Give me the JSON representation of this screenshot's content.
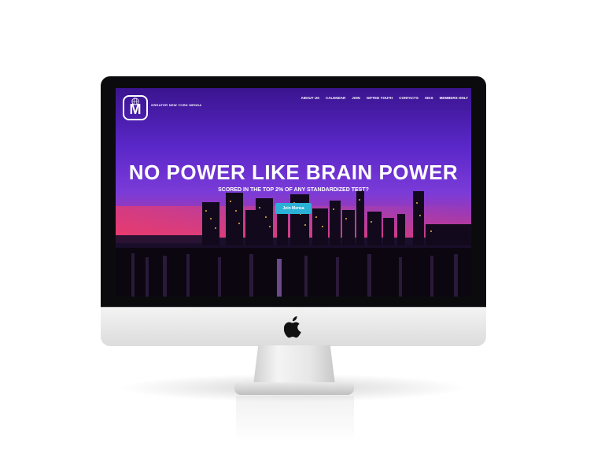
{
  "site": {
    "brand": "GREATER NEW YORK MENSA",
    "logo_letter": "M"
  },
  "nav": {
    "items": [
      "ABOUT US",
      "CALENDAR",
      "JOIN",
      "GIFTED YOUTH",
      "CONTACTS",
      "SIGS",
      "MEMBERS ONLY"
    ]
  },
  "hero": {
    "title": "NO POWER LIKE BRAIN POWER",
    "subtitle": "SCORED IN THE TOP 2% OF ANY STANDARDIZED TEST?",
    "cta_label": "Join Mensa"
  },
  "colors": {
    "sky_top": "#3a148f",
    "sky_mid": "#7a3bd8",
    "sunset": "#ee2a57",
    "button": "#2bb0d6"
  }
}
